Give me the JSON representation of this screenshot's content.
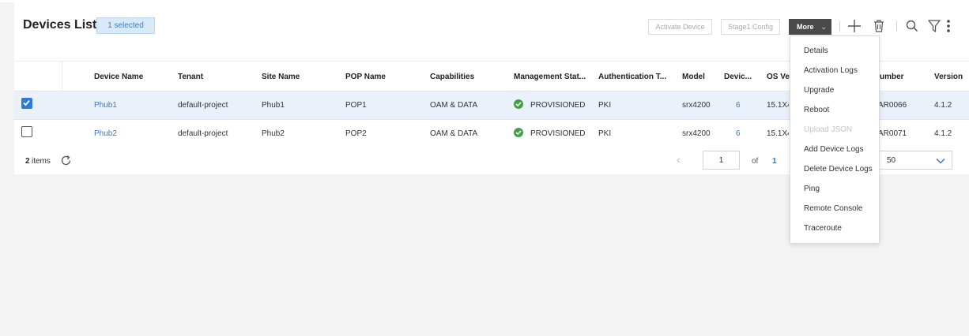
{
  "header": {
    "title": "Devices List",
    "selected_badge": "1 selected",
    "activate_label": "Activate Device",
    "stage1_label": "Stage1 Config",
    "more_label": "More",
    "icons": [
      "add-icon",
      "delete-icon",
      "search-icon",
      "filter-icon",
      "kebab-menu-icon"
    ]
  },
  "table": {
    "columns": [
      "Device Name",
      "Tenant",
      "Site Name",
      "POP Name",
      "Capabilities",
      "Management Stat...",
      "Authentication T...",
      "Model",
      "Devic...",
      "OS Ver",
      "umber",
      "Version"
    ],
    "rows": [
      {
        "selected": true,
        "device": "Phub1",
        "tenant": "default-project",
        "site": "Phub1",
        "pop": "POP1",
        "cap": "OAM & DATA",
        "mgmt": "PROVISIONED",
        "auth": "PKI",
        "model": "srx4200",
        "devic": "6",
        "os": "15.1X4",
        "number": "AR0066",
        "version": "4.1.2"
      },
      {
        "selected": false,
        "device": "Phub2",
        "tenant": "default-project",
        "site": "Phub2",
        "pop": "POP2",
        "cap": "OAM & DATA",
        "mgmt": "PROVISIONED",
        "auth": "PKI",
        "model": "srx4200",
        "devic": "6",
        "os": "15.1X4",
        "number": "AR0071",
        "version": "4.1.2"
      }
    ]
  },
  "footer": {
    "count": "2",
    "items_label": "items",
    "page_value": "1",
    "of_label": "of",
    "total_pages": "1",
    "page_size": "50"
  },
  "more_menu": {
    "items": [
      {
        "label": "Details",
        "disabled": false
      },
      {
        "label": "Activation Logs",
        "disabled": false
      },
      {
        "label": "Upgrade",
        "disabled": false
      },
      {
        "label": "Reboot",
        "disabled": false
      },
      {
        "label": "Upload JSON",
        "disabled": true
      },
      {
        "label": "Add Device Logs",
        "disabled": false
      },
      {
        "label": "Delete Device Logs",
        "disabled": false
      },
      {
        "label": "Ping",
        "disabled": false
      },
      {
        "label": "Remote Console",
        "disabled": false
      },
      {
        "label": "Traceroute",
        "disabled": false
      }
    ]
  },
  "colors": {
    "accent": "#3d77bd",
    "status_ok": "#43a047",
    "selected_row": "#eaf1fb",
    "more_button": "#4a4a4a"
  }
}
